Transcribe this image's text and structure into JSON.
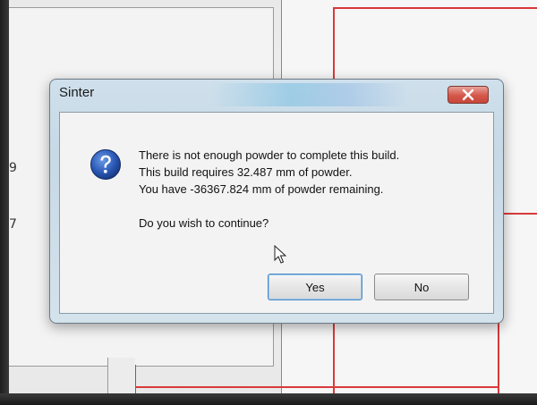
{
  "background": {
    "side_numbers": [
      "9",
      "7"
    ]
  },
  "dialog": {
    "title": "Sinter",
    "icon": "question-icon",
    "message_lines": [
      "There is not enough powder to complete this build.",
      "This build requires 32.487 mm of powder.",
      "You have -36367.824 mm of powder remaining."
    ],
    "question": "Do you wish to continue?",
    "buttons": {
      "yes": "Yes",
      "no": "No"
    },
    "close_icon": "close-icon"
  },
  "colors": {
    "accent_red": "#d9393a",
    "close_button": "#d4574a",
    "question_icon": "#2a58b5"
  }
}
